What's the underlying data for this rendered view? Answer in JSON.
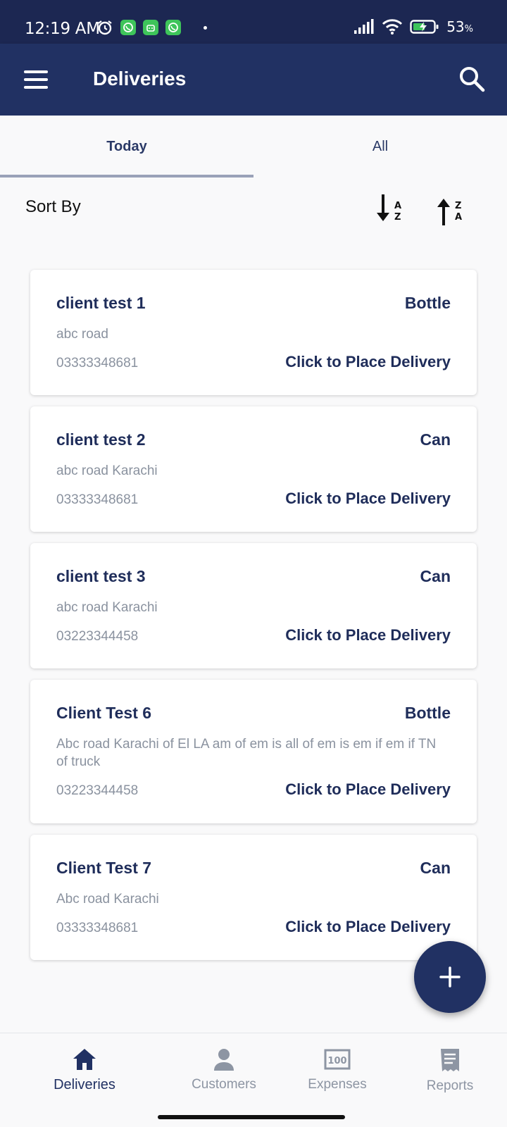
{
  "status_bar": {
    "time": "12:19 AM",
    "battery_percent": "53",
    "battery_unit": "%",
    "icons": [
      "alarm-icon",
      "whatsapp-icon",
      "android-icon",
      "whatsapp-icon",
      "signal-icon",
      "wifi-icon",
      "battery-charging-icon"
    ]
  },
  "app_bar": {
    "title": "Deliveries",
    "menu_icon": "hamburger-menu-icon",
    "search_icon": "search-icon"
  },
  "tabs": [
    {
      "label": "Today",
      "active": true
    },
    {
      "label": "All",
      "active": false
    }
  ],
  "sort": {
    "label": "Sort By",
    "asc_icon": "sort-a-z-icon",
    "desc_icon": "sort-z-a-icon"
  },
  "deliveries": [
    {
      "name": "client test 1",
      "product": "Bottle",
      "address": "abc road",
      "phone": "03333348681",
      "action": "Click to Place Delivery"
    },
    {
      "name": "client test 2",
      "product": "Can",
      "address": "abc road Karachi",
      "phone": "03333348681",
      "action": "Click to Place Delivery"
    },
    {
      "name": "client test 3",
      "product": "Can",
      "address": "abc road Karachi",
      "phone": "03223344458",
      "action": "Click to Place Delivery"
    },
    {
      "name": "Client Test 6",
      "product": "Bottle",
      "address": "Abc road Karachi of El LA am of em is all of em is em if em if TN of truck",
      "phone": "03223344458",
      "action": "Click to Place Delivery"
    },
    {
      "name": "Client Test 7",
      "product": "Can",
      "address": "Abc road Karachi",
      "phone": "03333348681",
      "action": "Click to Place Delivery"
    }
  ],
  "fab": {
    "icon": "plus-icon"
  },
  "bottom_nav": [
    {
      "label": "Deliveries",
      "icon": "home-icon",
      "active": true
    },
    {
      "label": "Customers",
      "icon": "person-icon",
      "active": false
    },
    {
      "label": "Expenses",
      "icon": "banknote-icon",
      "active": false
    },
    {
      "label": "Reports",
      "icon": "receipt-icon",
      "active": false
    }
  ],
  "colors": {
    "primary": "#213163",
    "status_bar": "#1c2752",
    "muted_text": "#8a929f",
    "background": "#f9f9fa"
  }
}
